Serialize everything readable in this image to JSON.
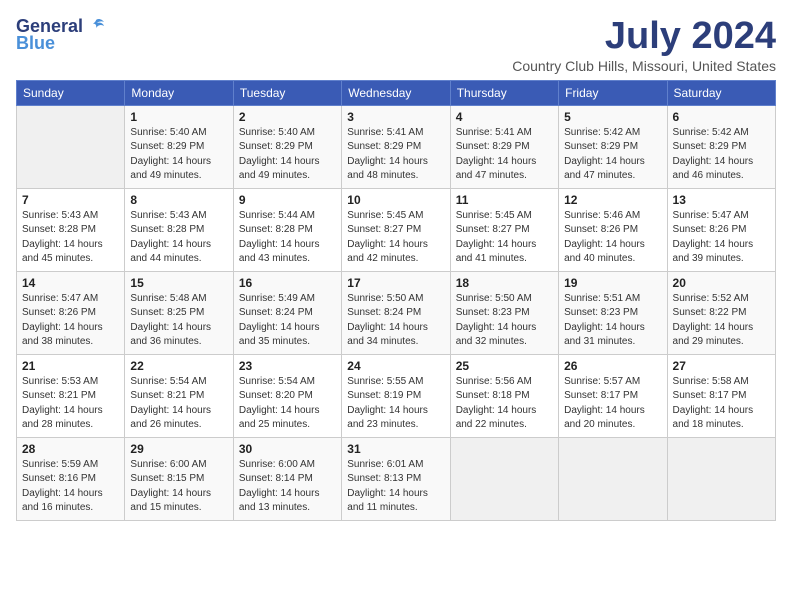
{
  "logo": {
    "general": "General",
    "blue": "Blue"
  },
  "title": "July 2024",
  "location": "Country Club Hills, Missouri, United States",
  "days_of_week": [
    "Sunday",
    "Monday",
    "Tuesday",
    "Wednesday",
    "Thursday",
    "Friday",
    "Saturday"
  ],
  "weeks": [
    [
      {
        "day": "",
        "info": ""
      },
      {
        "day": "1",
        "info": "Sunrise: 5:40 AM\nSunset: 8:29 PM\nDaylight: 14 hours\nand 49 minutes."
      },
      {
        "day": "2",
        "info": "Sunrise: 5:40 AM\nSunset: 8:29 PM\nDaylight: 14 hours\nand 49 minutes."
      },
      {
        "day": "3",
        "info": "Sunrise: 5:41 AM\nSunset: 8:29 PM\nDaylight: 14 hours\nand 48 minutes."
      },
      {
        "day": "4",
        "info": "Sunrise: 5:41 AM\nSunset: 8:29 PM\nDaylight: 14 hours\nand 47 minutes."
      },
      {
        "day": "5",
        "info": "Sunrise: 5:42 AM\nSunset: 8:29 PM\nDaylight: 14 hours\nand 47 minutes."
      },
      {
        "day": "6",
        "info": "Sunrise: 5:42 AM\nSunset: 8:29 PM\nDaylight: 14 hours\nand 46 minutes."
      }
    ],
    [
      {
        "day": "7",
        "info": "Sunrise: 5:43 AM\nSunset: 8:28 PM\nDaylight: 14 hours\nand 45 minutes."
      },
      {
        "day": "8",
        "info": "Sunrise: 5:43 AM\nSunset: 8:28 PM\nDaylight: 14 hours\nand 44 minutes."
      },
      {
        "day": "9",
        "info": "Sunrise: 5:44 AM\nSunset: 8:28 PM\nDaylight: 14 hours\nand 43 minutes."
      },
      {
        "day": "10",
        "info": "Sunrise: 5:45 AM\nSunset: 8:27 PM\nDaylight: 14 hours\nand 42 minutes."
      },
      {
        "day": "11",
        "info": "Sunrise: 5:45 AM\nSunset: 8:27 PM\nDaylight: 14 hours\nand 41 minutes."
      },
      {
        "day": "12",
        "info": "Sunrise: 5:46 AM\nSunset: 8:26 PM\nDaylight: 14 hours\nand 40 minutes."
      },
      {
        "day": "13",
        "info": "Sunrise: 5:47 AM\nSunset: 8:26 PM\nDaylight: 14 hours\nand 39 minutes."
      }
    ],
    [
      {
        "day": "14",
        "info": "Sunrise: 5:47 AM\nSunset: 8:26 PM\nDaylight: 14 hours\nand 38 minutes."
      },
      {
        "day": "15",
        "info": "Sunrise: 5:48 AM\nSunset: 8:25 PM\nDaylight: 14 hours\nand 36 minutes."
      },
      {
        "day": "16",
        "info": "Sunrise: 5:49 AM\nSunset: 8:24 PM\nDaylight: 14 hours\nand 35 minutes."
      },
      {
        "day": "17",
        "info": "Sunrise: 5:50 AM\nSunset: 8:24 PM\nDaylight: 14 hours\nand 34 minutes."
      },
      {
        "day": "18",
        "info": "Sunrise: 5:50 AM\nSunset: 8:23 PM\nDaylight: 14 hours\nand 32 minutes."
      },
      {
        "day": "19",
        "info": "Sunrise: 5:51 AM\nSunset: 8:23 PM\nDaylight: 14 hours\nand 31 minutes."
      },
      {
        "day": "20",
        "info": "Sunrise: 5:52 AM\nSunset: 8:22 PM\nDaylight: 14 hours\nand 29 minutes."
      }
    ],
    [
      {
        "day": "21",
        "info": "Sunrise: 5:53 AM\nSunset: 8:21 PM\nDaylight: 14 hours\nand 28 minutes."
      },
      {
        "day": "22",
        "info": "Sunrise: 5:54 AM\nSunset: 8:21 PM\nDaylight: 14 hours\nand 26 minutes."
      },
      {
        "day": "23",
        "info": "Sunrise: 5:54 AM\nSunset: 8:20 PM\nDaylight: 14 hours\nand 25 minutes."
      },
      {
        "day": "24",
        "info": "Sunrise: 5:55 AM\nSunset: 8:19 PM\nDaylight: 14 hours\nand 23 minutes."
      },
      {
        "day": "25",
        "info": "Sunrise: 5:56 AM\nSunset: 8:18 PM\nDaylight: 14 hours\nand 22 minutes."
      },
      {
        "day": "26",
        "info": "Sunrise: 5:57 AM\nSunset: 8:17 PM\nDaylight: 14 hours\nand 20 minutes."
      },
      {
        "day": "27",
        "info": "Sunrise: 5:58 AM\nSunset: 8:17 PM\nDaylight: 14 hours\nand 18 minutes."
      }
    ],
    [
      {
        "day": "28",
        "info": "Sunrise: 5:59 AM\nSunset: 8:16 PM\nDaylight: 14 hours\nand 16 minutes."
      },
      {
        "day": "29",
        "info": "Sunrise: 6:00 AM\nSunset: 8:15 PM\nDaylight: 14 hours\nand 15 minutes."
      },
      {
        "day": "30",
        "info": "Sunrise: 6:00 AM\nSunset: 8:14 PM\nDaylight: 14 hours\nand 13 minutes."
      },
      {
        "day": "31",
        "info": "Sunrise: 6:01 AM\nSunset: 8:13 PM\nDaylight: 14 hours\nand 11 minutes."
      },
      {
        "day": "",
        "info": ""
      },
      {
        "day": "",
        "info": ""
      },
      {
        "day": "",
        "info": ""
      }
    ]
  ]
}
